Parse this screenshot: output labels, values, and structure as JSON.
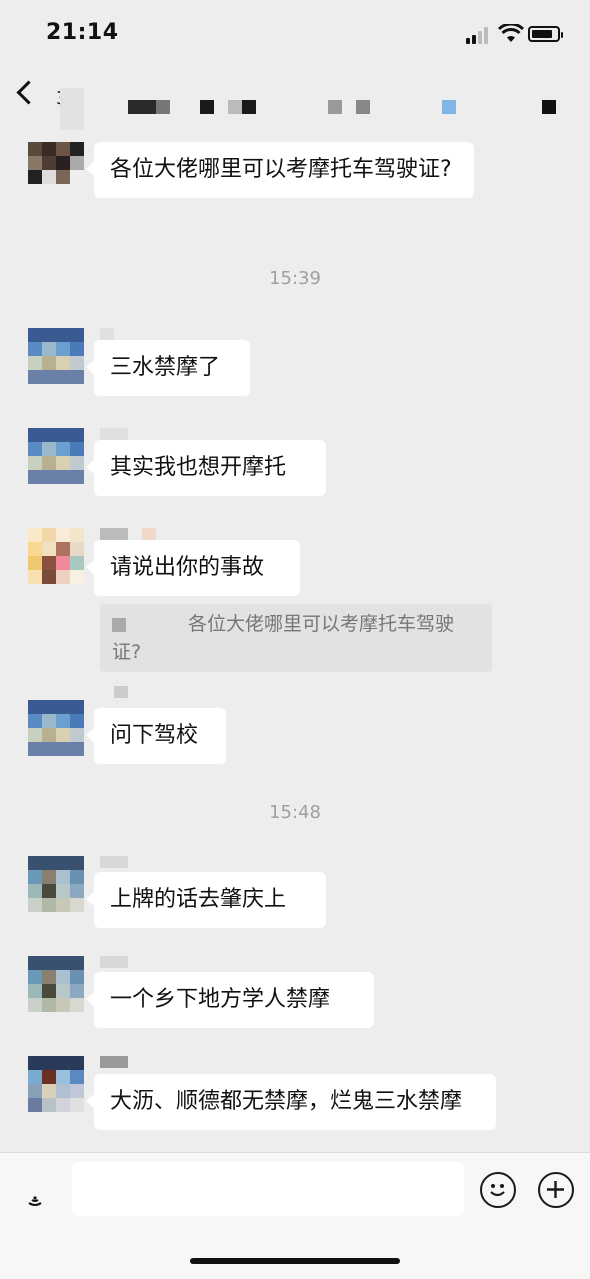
{
  "status_bar": {
    "time": "21:14"
  },
  "nav": {
    "back_count": "3"
  },
  "messages": [
    {
      "text": "各位大佬哪里可以考摩托车驾驶证?"
    },
    {
      "text": "三水禁摩了"
    },
    {
      "text": "其实我也想开摩托"
    },
    {
      "text": "请说出你的事故"
    },
    {
      "text": "问下驾校"
    },
    {
      "text": "上牌的话去肇庆上"
    },
    {
      "text": "一个乡下地方学人禁摩"
    },
    {
      "text": "大沥、顺德都无禁摩，烂鬼三水禁摩"
    }
  ],
  "timestamps": [
    "15:39",
    "15:48"
  ],
  "quote": {
    "text": "各位大佬哪里可以考摩托车驾驶证?"
  },
  "icons": {
    "back": "chevron-left-icon",
    "voice": "voice-icon",
    "emoji": "emoji-icon",
    "add": "plus-icon"
  }
}
